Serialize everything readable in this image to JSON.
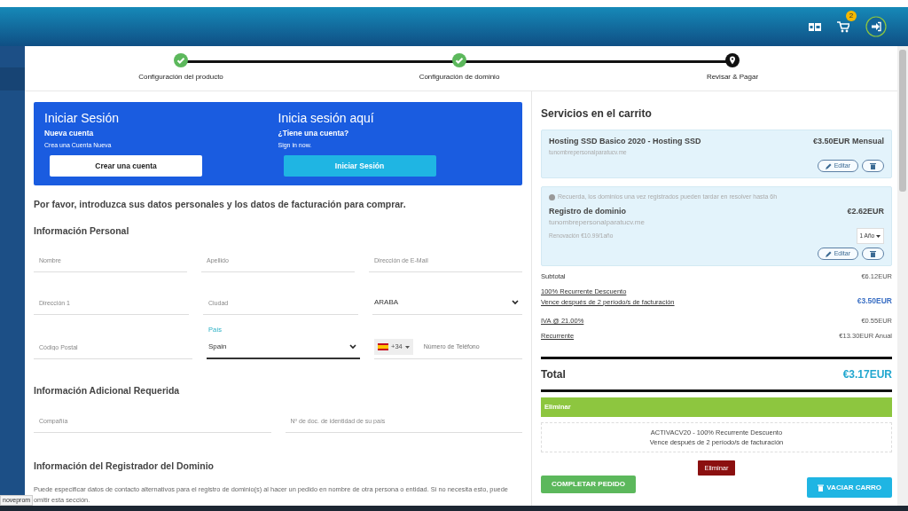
{
  "header": {
    "cart_count": "2"
  },
  "steps": [
    {
      "label": "Configuración del producto",
      "done": true
    },
    {
      "label": "Configuración de dominio",
      "done": true
    },
    {
      "label": "Revisar & Pagar",
      "done": false
    }
  ],
  "login": {
    "left": {
      "title": "Iniciar Sesión",
      "subtitle": "Nueva cuenta",
      "text": "Crea una Cuenta Nueva",
      "button": "Crear una cuenta"
    },
    "right": {
      "title": "Inicia sesión aquí",
      "subtitle": "¿Tiene una cuenta?",
      "text": "Sign in now.",
      "button": "Iniciar Sesión"
    }
  },
  "intro": "Por favor, introduzca sus datos personales y los datos de facturación para comprar.",
  "personal": {
    "title": "Información Personal",
    "rows": [
      [
        {
          "kind": "input",
          "placeholder": "Nombre"
        },
        {
          "kind": "input",
          "placeholder": "Apellido"
        },
        {
          "kind": "input",
          "placeholder": "Dirección de E-Mail"
        }
      ],
      [
        {
          "kind": "input",
          "placeholder": "Dirección 1"
        },
        {
          "kind": "input",
          "placeholder": "Ciudad"
        },
        {
          "kind": "select",
          "value": "ARABA"
        }
      ],
      [
        {
          "kind": "input",
          "placeholder": "Código Postal"
        },
        {
          "kind": "select",
          "label": "País",
          "value": "Spain",
          "focused": true
        },
        {
          "kind": "phone",
          "code": "+34",
          "placeholder": "Número de Teléfono"
        }
      ]
    ]
  },
  "additional": {
    "title": "Información Adicional Requerida",
    "fields": [
      {
        "placeholder": "Compañía"
      },
      {
        "placeholder": "Nº de doc. de identidad de su país"
      }
    ]
  },
  "registrar": {
    "title": "Información del Registrador del Dominio",
    "text": "Puede especificar datos de contacto alternativos para el registro de dominio(s) al hacer un pedido en nombre de otra persona o entidad. Si no necesita esto, puede omitir esta sección."
  },
  "cart": {
    "title": "Servicios en el carrito",
    "items": [
      {
        "name": "Hosting SSD Basico 2020 - Hosting SSD",
        "price": "€3.50EUR Mensual",
        "domain": "tunombrepersonalparatucv.me",
        "edit": "Editar"
      },
      {
        "notice": "Recuerda, los dominios una vez registrados pueden tardar en resolver hasta 6h",
        "name": "Registro de dominio",
        "price": "€2.62EUR",
        "domain": "tunombrepersonalparatucv.me",
        "renewal": "Renovación €10.99/1año",
        "period": "1 Año",
        "edit": "Editar"
      }
    ],
    "summary": [
      {
        "label": "Subtotal",
        "value": "€6.12EUR",
        "underlined": false,
        "accent": false
      },
      {
        "label": "100% Recurrente Descuento",
        "label2": "Vence después de 2 período/s de facturación",
        "value": "€3.50EUR",
        "underlined": true,
        "accent": true
      },
      {
        "label": "IVA @ 21.00%",
        "value": "€0.55EUR",
        "underlined": true,
        "accent": false
      },
      {
        "label": "Recurrente",
        "value": "€13.30EUR Anual",
        "underlined": true,
        "accent": false
      }
    ],
    "total_label": "Total",
    "total": "€3.17EUR",
    "promo_bar": "Eliminar",
    "promo_lines": [
      "ACTIVACV20 - 100% Recurrente Descuento",
      "Vence después de 2 período/s de facturación"
    ],
    "promo_remove": "Eliminar",
    "checkout": "COMPLETAR PEDIDO",
    "empty": "VACIAR CARRO"
  },
  "status_url": "noveprom"
}
